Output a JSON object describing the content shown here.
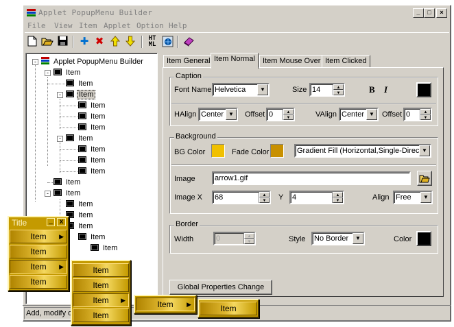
{
  "window": {
    "title": "Applet PopupMenu Builder"
  },
  "menubar": [
    "File",
    "View",
    "Item",
    "Applet",
    "Option",
    "Help"
  ],
  "toolbar": [
    "new-icon",
    "open-icon",
    "save-icon",
    "add-icon",
    "delete-icon",
    "move-up-icon",
    "move-down-icon",
    "html-icon",
    "browser-preview-icon",
    "help-book-icon"
  ],
  "tree": {
    "root": "Applet PopupMenu Builder",
    "item_label": "Item"
  },
  "tabs": [
    "Item General",
    "Item Normal",
    "Item Mouse Over",
    "Item Clicked"
  ],
  "active_tab": 1,
  "caption": {
    "group": "Caption",
    "font_name_label": "Font Name",
    "font_name": "Helvetica",
    "size_label": "Size",
    "size": "14",
    "bold": "B",
    "italic": "I",
    "text_color": "#000000",
    "halign_label": "HAlign",
    "halign": "Center",
    "offset_label": "Offset",
    "h_offset": "0",
    "valign_label": "VAlign",
    "valign": "Center",
    "v_offset": "0"
  },
  "background": {
    "group": "Background",
    "bg_color_label": "BG Color",
    "bg_color": "#f0c000",
    "fade_color_label": "Fade Color",
    "fade_color": "#c89000",
    "fill_mode": "Gradient Fill (Horizontal,Single-Directic",
    "image_label": "Image",
    "image": "arrow1.gif",
    "imagex_label": "Image X",
    "imagex": "68",
    "y_label": "Y",
    "imagey": "4",
    "align_label": "Align",
    "align": "Free"
  },
  "border": {
    "group": "Border",
    "width_label": "Width",
    "width": "0",
    "style_label": "Style",
    "style": "No Border",
    "color_label": "Color",
    "color": "#000000"
  },
  "global_button": "Global Properties Change",
  "status_text": "Add, modify o",
  "demo_menu": {
    "title": "Title",
    "min": "_",
    "close": "x",
    "item": "Item"
  },
  "colors": {
    "menu_gold": "#c49a00",
    "face": "#d4d0c8"
  }
}
